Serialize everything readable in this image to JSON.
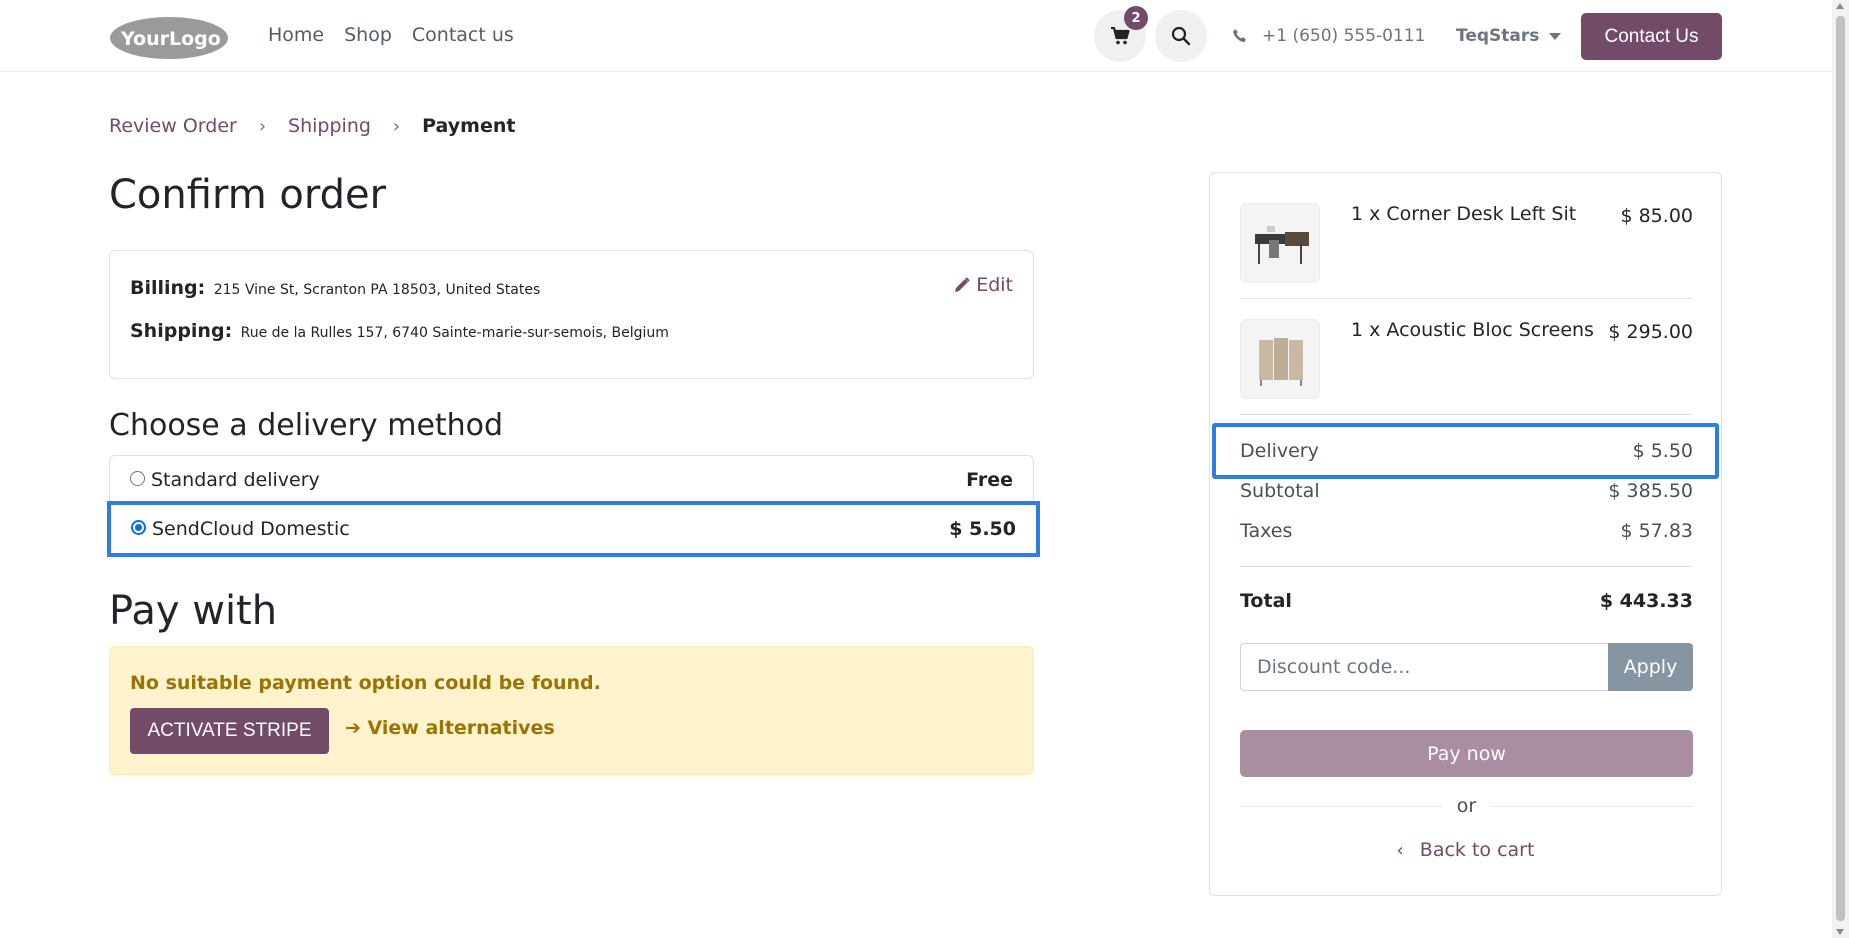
{
  "header": {
    "logo_text": "YourLogo",
    "nav": [
      "Home",
      "Shop",
      "Contact us"
    ],
    "cart_count": "2",
    "phone": "+1 (650) 555-0111",
    "user": "TeqStars",
    "contact_button": "Contact Us"
  },
  "breadcrumb": {
    "steps": [
      "Review Order",
      "Shipping"
    ],
    "current": "Payment"
  },
  "page_title": "Confirm order",
  "address": {
    "billing_label": "Billing:",
    "billing_value": "215 Vine St, Scranton PA 18503, United States",
    "shipping_label": "Shipping:",
    "shipping_value": "Rue de la Rulles 157, 6740 Sainte-marie-sur-semois, Belgium",
    "edit_label": "Edit"
  },
  "delivery": {
    "title": "Choose a delivery method",
    "options": [
      {
        "label": "Standard delivery",
        "price": "Free",
        "selected": false
      },
      {
        "label": "SendCloud Domestic",
        "price": "$ 5.50",
        "selected": true
      }
    ]
  },
  "payment": {
    "title": "Pay with",
    "alert": "No suitable payment option could be found.",
    "activate_button": "ACTIVATE STRIPE",
    "alternatives_link": "View alternatives"
  },
  "summary": {
    "items": [
      {
        "name": "1 x Corner Desk Left Sit",
        "price": "$ 85.00"
      },
      {
        "name": "1 x Acoustic Bloc Screens",
        "price": "$ 295.00"
      }
    ],
    "delivery_label": "Delivery",
    "delivery_value": "$ 5.50",
    "subtotal_label": "Subtotal",
    "subtotal_value": "$ 385.50",
    "taxes_label": "Taxes",
    "taxes_value": "$ 57.83",
    "total_label": "Total",
    "total_value": "$ 443.33",
    "discount_placeholder": "Discount code...",
    "apply_label": "Apply",
    "pay_label": "Pay now",
    "or_label": "or",
    "back_label": "Back to cart"
  },
  "colors": {
    "brand": "#714b67",
    "highlight": "#2f7de1",
    "alert_bg": "#fff3cd",
    "alert_text": "#997404"
  }
}
